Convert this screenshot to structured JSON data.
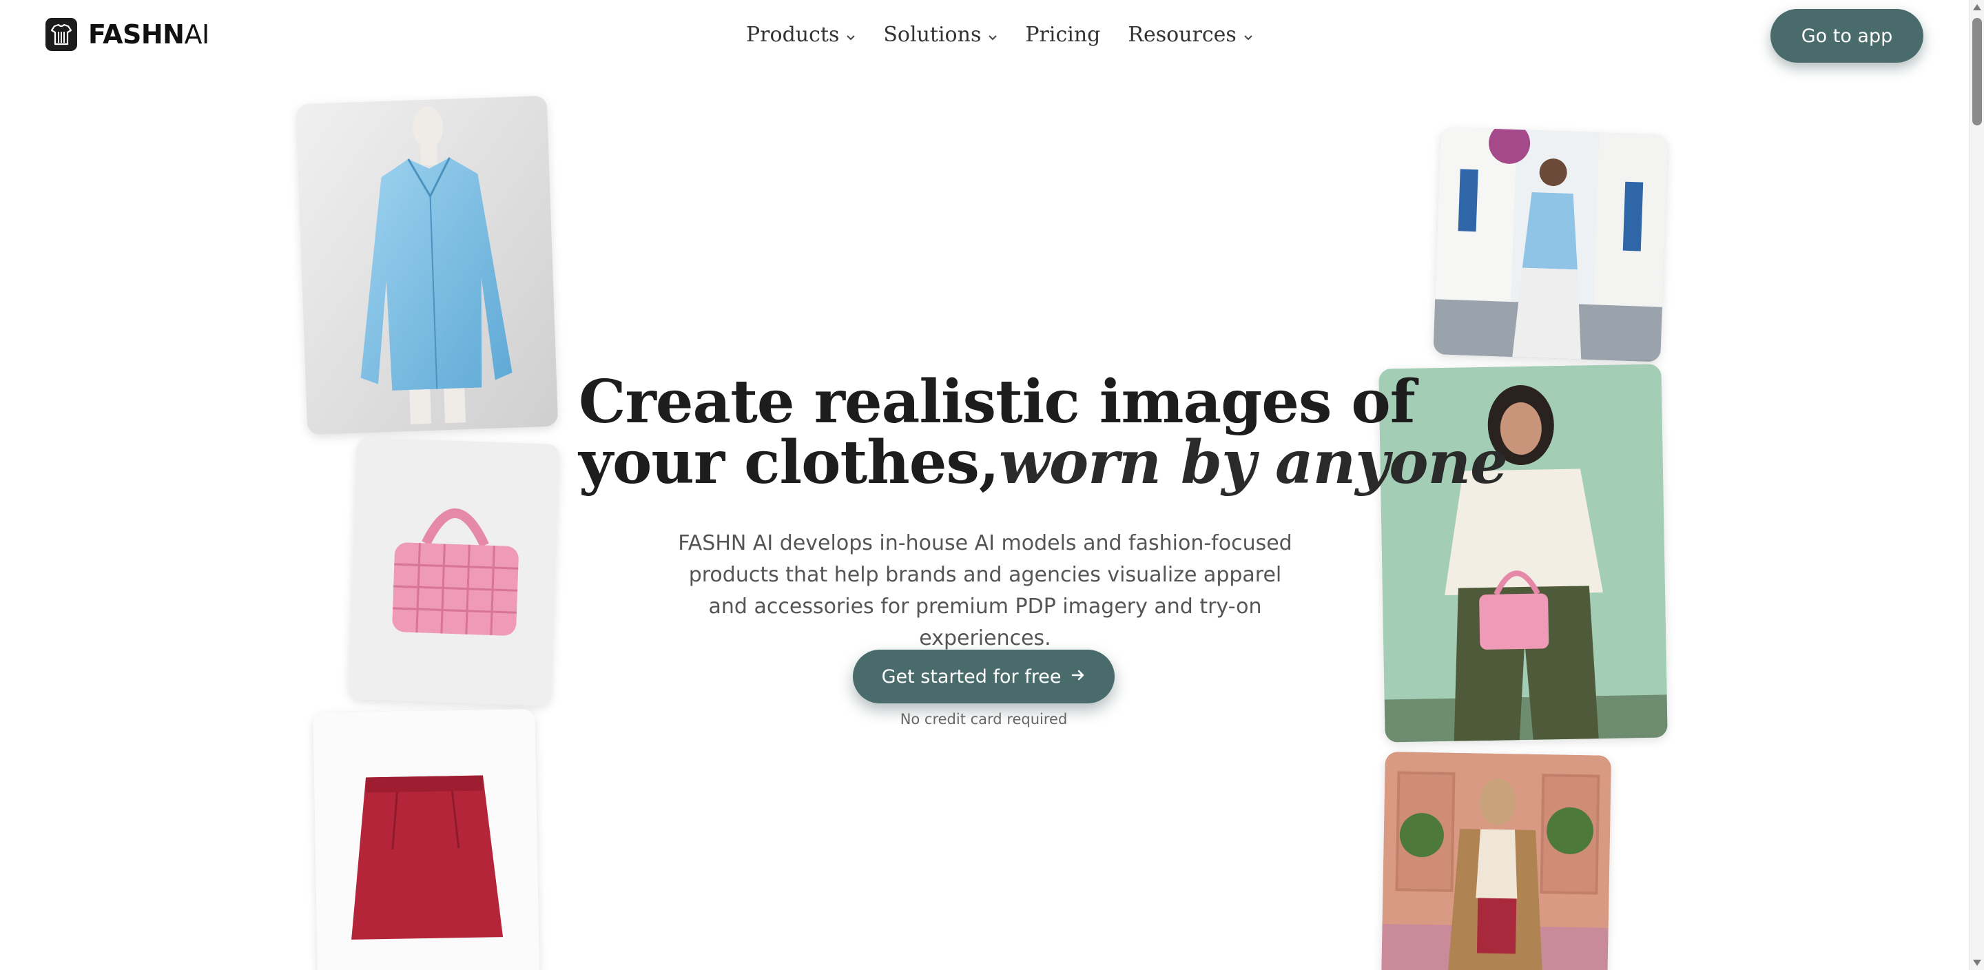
{
  "brand": {
    "name_bold": "FASHN",
    "name_light": "AI"
  },
  "nav": {
    "items": [
      {
        "label": "Products",
        "has_dropdown": true
      },
      {
        "label": "Solutions",
        "has_dropdown": true
      },
      {
        "label": "Pricing",
        "has_dropdown": false
      },
      {
        "label": "Resources",
        "has_dropdown": true
      }
    ]
  },
  "header": {
    "cta_label": "Go to app"
  },
  "hero": {
    "title_line1": "Create realistic images of",
    "title_line2_plain": "your clothes,",
    "title_line2_italic": "worn by anyone",
    "description": "FASHN AI develops in-house AI models and fashion-focused products that help brands and agencies visualize apparel and accessories for premium PDP imagery and try-on experiences.",
    "cta_label": "Get started for free",
    "cta_note": "No credit card required"
  },
  "colors": {
    "accent": "#4a6b6b",
    "text": "#1d1d1d",
    "muted": "#555555"
  },
  "icons": {
    "chevron": "chevron-down-icon",
    "arrow": "arrow-right-icon",
    "logo": "shirt-logo-icon"
  }
}
